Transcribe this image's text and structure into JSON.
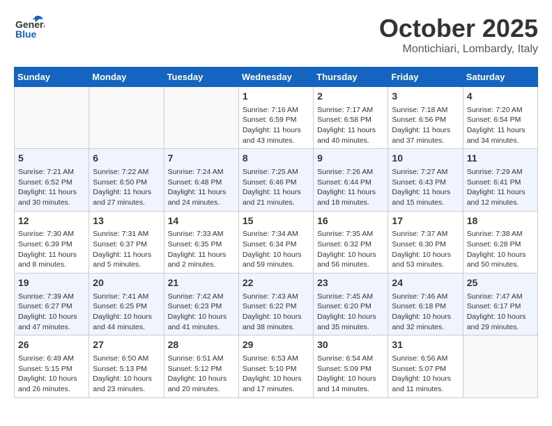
{
  "logo": {
    "text_general": "General",
    "text_blue": "Blue"
  },
  "title": "October 2025",
  "subtitle": "Montichiari, Lombardy, Italy",
  "weekdays": [
    "Sunday",
    "Monday",
    "Tuesday",
    "Wednesday",
    "Thursday",
    "Friday",
    "Saturday"
  ],
  "weeks": [
    [
      {
        "day": "",
        "info": ""
      },
      {
        "day": "",
        "info": ""
      },
      {
        "day": "",
        "info": ""
      },
      {
        "day": "1",
        "info": "Sunrise: 7:16 AM\nSunset: 6:59 PM\nDaylight: 11 hours\nand 43 minutes."
      },
      {
        "day": "2",
        "info": "Sunrise: 7:17 AM\nSunset: 6:58 PM\nDaylight: 11 hours\nand 40 minutes."
      },
      {
        "day": "3",
        "info": "Sunrise: 7:18 AM\nSunset: 6:56 PM\nDaylight: 11 hours\nand 37 minutes."
      },
      {
        "day": "4",
        "info": "Sunrise: 7:20 AM\nSunset: 6:54 PM\nDaylight: 11 hours\nand 34 minutes."
      }
    ],
    [
      {
        "day": "5",
        "info": "Sunrise: 7:21 AM\nSunset: 6:52 PM\nDaylight: 11 hours\nand 30 minutes."
      },
      {
        "day": "6",
        "info": "Sunrise: 7:22 AM\nSunset: 6:50 PM\nDaylight: 11 hours\nand 27 minutes."
      },
      {
        "day": "7",
        "info": "Sunrise: 7:24 AM\nSunset: 6:48 PM\nDaylight: 11 hours\nand 24 minutes."
      },
      {
        "day": "8",
        "info": "Sunrise: 7:25 AM\nSunset: 6:46 PM\nDaylight: 11 hours\nand 21 minutes."
      },
      {
        "day": "9",
        "info": "Sunrise: 7:26 AM\nSunset: 6:44 PM\nDaylight: 11 hours\nand 18 minutes."
      },
      {
        "day": "10",
        "info": "Sunrise: 7:27 AM\nSunset: 6:43 PM\nDaylight: 11 hours\nand 15 minutes."
      },
      {
        "day": "11",
        "info": "Sunrise: 7:29 AM\nSunset: 6:41 PM\nDaylight: 11 hours\nand 12 minutes."
      }
    ],
    [
      {
        "day": "12",
        "info": "Sunrise: 7:30 AM\nSunset: 6:39 PM\nDaylight: 11 hours\nand 8 minutes."
      },
      {
        "day": "13",
        "info": "Sunrise: 7:31 AM\nSunset: 6:37 PM\nDaylight: 11 hours\nand 5 minutes."
      },
      {
        "day": "14",
        "info": "Sunrise: 7:33 AM\nSunset: 6:35 PM\nDaylight: 11 hours\nand 2 minutes."
      },
      {
        "day": "15",
        "info": "Sunrise: 7:34 AM\nSunset: 6:34 PM\nDaylight: 10 hours\nand 59 minutes."
      },
      {
        "day": "16",
        "info": "Sunrise: 7:35 AM\nSunset: 6:32 PM\nDaylight: 10 hours\nand 56 minutes."
      },
      {
        "day": "17",
        "info": "Sunrise: 7:37 AM\nSunset: 6:30 PM\nDaylight: 10 hours\nand 53 minutes."
      },
      {
        "day": "18",
        "info": "Sunrise: 7:38 AM\nSunset: 6:28 PM\nDaylight: 10 hours\nand 50 minutes."
      }
    ],
    [
      {
        "day": "19",
        "info": "Sunrise: 7:39 AM\nSunset: 6:27 PM\nDaylight: 10 hours\nand 47 minutes."
      },
      {
        "day": "20",
        "info": "Sunrise: 7:41 AM\nSunset: 6:25 PM\nDaylight: 10 hours\nand 44 minutes."
      },
      {
        "day": "21",
        "info": "Sunrise: 7:42 AM\nSunset: 6:23 PM\nDaylight: 10 hours\nand 41 minutes."
      },
      {
        "day": "22",
        "info": "Sunrise: 7:43 AM\nSunset: 6:22 PM\nDaylight: 10 hours\nand 38 minutes."
      },
      {
        "day": "23",
        "info": "Sunrise: 7:45 AM\nSunset: 6:20 PM\nDaylight: 10 hours\nand 35 minutes."
      },
      {
        "day": "24",
        "info": "Sunrise: 7:46 AM\nSunset: 6:18 PM\nDaylight: 10 hours\nand 32 minutes."
      },
      {
        "day": "25",
        "info": "Sunrise: 7:47 AM\nSunset: 6:17 PM\nDaylight: 10 hours\nand 29 minutes."
      }
    ],
    [
      {
        "day": "26",
        "info": "Sunrise: 6:49 AM\nSunset: 5:15 PM\nDaylight: 10 hours\nand 26 minutes."
      },
      {
        "day": "27",
        "info": "Sunrise: 6:50 AM\nSunset: 5:13 PM\nDaylight: 10 hours\nand 23 minutes."
      },
      {
        "day": "28",
        "info": "Sunrise: 6:51 AM\nSunset: 5:12 PM\nDaylight: 10 hours\nand 20 minutes."
      },
      {
        "day": "29",
        "info": "Sunrise: 6:53 AM\nSunset: 5:10 PM\nDaylight: 10 hours\nand 17 minutes."
      },
      {
        "day": "30",
        "info": "Sunrise: 6:54 AM\nSunset: 5:09 PM\nDaylight: 10 hours\nand 14 minutes."
      },
      {
        "day": "31",
        "info": "Sunrise: 6:56 AM\nSunset: 5:07 PM\nDaylight: 10 hours\nand 11 minutes."
      },
      {
        "day": "",
        "info": ""
      }
    ]
  ]
}
